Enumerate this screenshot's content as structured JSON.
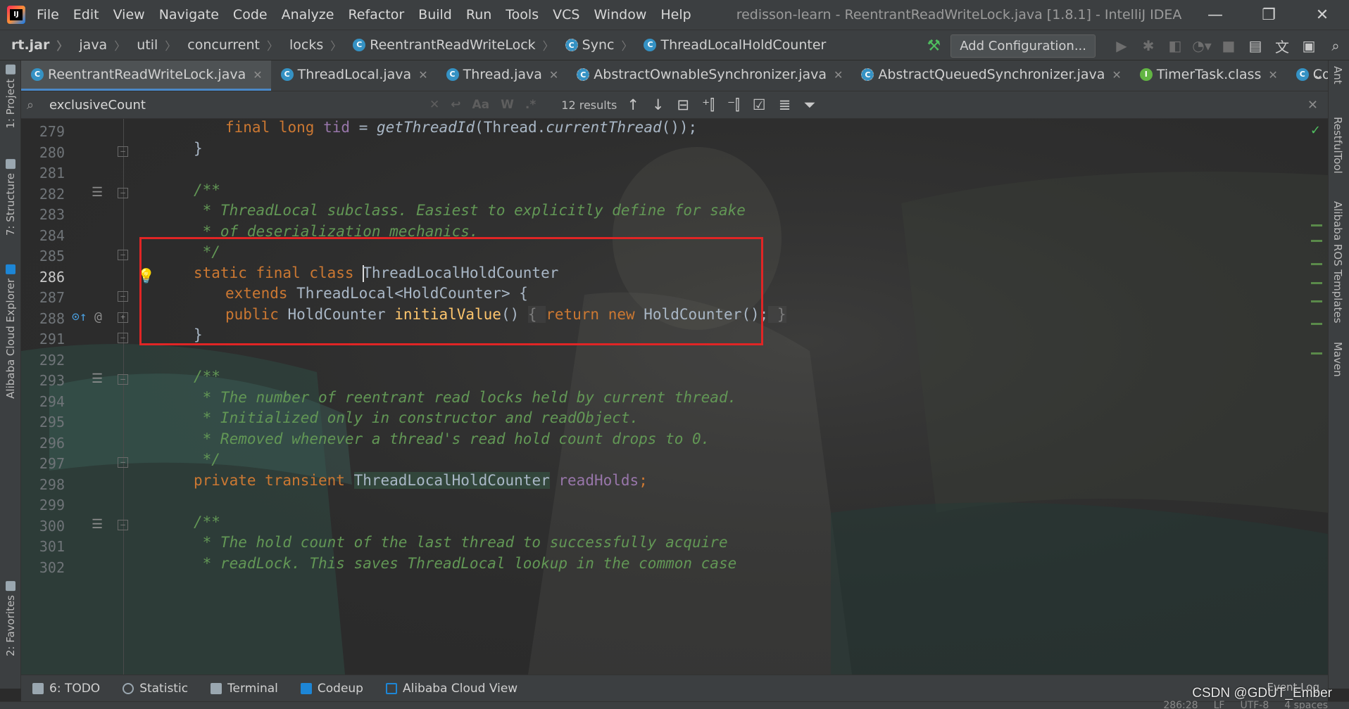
{
  "window": {
    "title": "redisson-learn - ReentrantReadWriteLock.java [1.8.1] - IntelliJ IDEA",
    "menu": [
      "File",
      "Edit",
      "View",
      "Navigate",
      "Code",
      "Analyze",
      "Refactor",
      "Build",
      "Run",
      "Tools",
      "VCS",
      "Window",
      "Help"
    ],
    "controls": {
      "minimize": "—",
      "restore": "❐",
      "close": "✕"
    }
  },
  "breadcrumbs": [
    "rt.jar",
    "java",
    "util",
    "concurrent",
    "locks",
    "ReentrantReadWriteLock",
    "Sync",
    "ThreadLocalHoldCounter"
  ],
  "toolbar": {
    "add_configuration": "Add Configuration..."
  },
  "tabs": [
    {
      "label": "ReentrantReadWriteLock.java",
      "icon": "class-icon",
      "active": true
    },
    {
      "label": "ThreadLocal.java",
      "icon": "class-icon",
      "active": false
    },
    {
      "label": "Thread.java",
      "icon": "class-icon",
      "active": false
    },
    {
      "label": "AbstractOwnableSynchronizer.java",
      "icon": "abstract-class-icon",
      "active": false
    },
    {
      "label": "AbstractQueuedSynchronizer.java",
      "icon": "abstract-class-icon",
      "active": false
    },
    {
      "label": "TimerTask.class",
      "icon": "interface-icon",
      "active": false
    },
    {
      "label": "CommandB",
      "icon": "class-icon",
      "active": false
    }
  ],
  "find": {
    "query": "exclusiveCount",
    "results": "12 results",
    "options": [
      "Aa",
      "W",
      ".*"
    ]
  },
  "editor": {
    "line_numbers": [
      "279",
      "280",
      "281",
      "282",
      "283",
      "284",
      "285",
      "286",
      "287",
      "288",
      "291",
      "292",
      "293",
      "294",
      "295",
      "296",
      "297",
      "298",
      "299",
      "300",
      "301",
      "302"
    ],
    "current_line": "286",
    "code": {
      "l279": [
        "final",
        "long",
        "tid",
        "=",
        "getThreadId",
        "(Thread.",
        "currentThread",
        "());"
      ],
      "l280": "}",
      "l282": "/**",
      "l283": " * ThreadLocal subclass. Easiest to explicitly define for sake",
      "l284": " * of deserialization mechanics.",
      "l285": " */",
      "l286": [
        "static final class ",
        "ThreadLocalHoldCounter"
      ],
      "l287": [
        "extends ",
        "ThreadLocal<HoldCounter> {"
      ],
      "l288": [
        "public ",
        "HoldCounter ",
        "initialValue",
        "() ",
        "{ ",
        "return new ",
        "HoldCounter();",
        " }"
      ],
      "l291": "}",
      "l293": "/**",
      "l294": " * The number of reentrant read locks held by current thread.",
      "l295": " * Initialized only in constructor and readObject.",
      "l296": " * Removed whenever a thread's read hold count drops to 0.",
      "l297": " */",
      "l298": [
        "private transient ",
        "ThreadLocalHoldCounter",
        " ",
        "readHolds",
        ";"
      ],
      "l300": "/**",
      "l301": " * The hold count of the last thread to successfully acquire",
      "l302": " * readLock. This saves ThreadLocal lookup in the common case"
    },
    "highlight_color": "#e02525"
  },
  "left_tools": [
    "1: Project",
    "7: Structure",
    "Alibaba Cloud Explorer",
    "2: Favorites"
  ],
  "right_tools": [
    "Ant",
    "RestfulTool",
    "Alibaba ROS Templates",
    "Maven"
  ],
  "bottom_tools": [
    "6: TODO",
    "Statistic",
    "Terminal",
    "Codeup",
    "Alibaba Cloud View"
  ],
  "status": {
    "event_log": "Event Log",
    "position": "286:28",
    "line_sep": "LF",
    "encoding": "UTF-8",
    "indent": "4 spaces"
  },
  "watermark": "CSDN @GDUT_Ember",
  "colors": {
    "keyword": "#cc7832",
    "comment": "#629755",
    "field": "#9876aa",
    "method": "#ffc66d",
    "text": "#a9b7c6",
    "background": "#2b2b2b"
  }
}
